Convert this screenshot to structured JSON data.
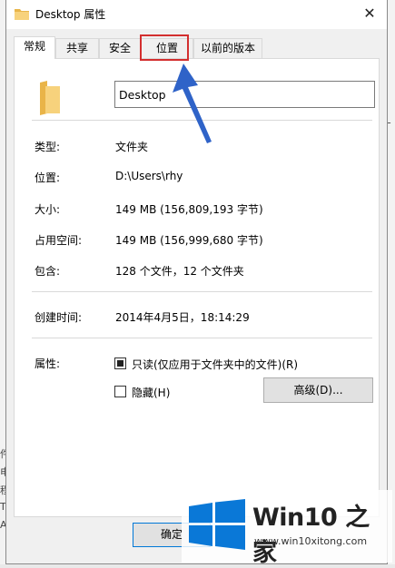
{
  "window": {
    "title": "Desktop 属性",
    "close_symbol": "✕"
  },
  "tabs": [
    {
      "label": "常规",
      "active": true
    },
    {
      "label": "共享",
      "active": false
    },
    {
      "label": "安全",
      "active": false
    },
    {
      "label": "位置",
      "active": false,
      "highlighted": true
    },
    {
      "label": "以前的版本",
      "active": false
    }
  ],
  "general": {
    "name_value": "Desktop",
    "fields": [
      {
        "label": "类型:",
        "value": "文件夹"
      },
      {
        "label": "位置:",
        "value": "D:\\Users\\rhy"
      },
      {
        "label": "大小:",
        "value": "149 MB (156,809,193 字节)"
      },
      {
        "label": "占用空间:",
        "value": "149 MB (156,999,680 字节)"
      },
      {
        "label": "包含:",
        "value": "128 个文件，12 个文件夹"
      }
    ],
    "created_label": "创建时间:",
    "created_value": "2014年4月5日，18:14:29",
    "attributes_label": "属性:",
    "readonly_label": "只读(仅应用于文件夹中的文件)(R)",
    "readonly_checked": true,
    "hidden_label": "隐藏(H)",
    "hidden_checked": false,
    "advanced_label": "高级(D)..."
  },
  "footer": {
    "ok_label": "确定"
  },
  "watermark": {
    "brand": "Win10 之家",
    "url": "www.win10xitong.com"
  },
  "background_window": {
    "left_chars": [
      "件",
      "电",
      "程",
      "T",
      "A"
    ],
    "right_char": "L"
  },
  "colors": {
    "highlight": "#d32f2f",
    "arrow": "#2f63c8",
    "folder": "#f5c86a",
    "win_logo": "#0a78d7"
  }
}
